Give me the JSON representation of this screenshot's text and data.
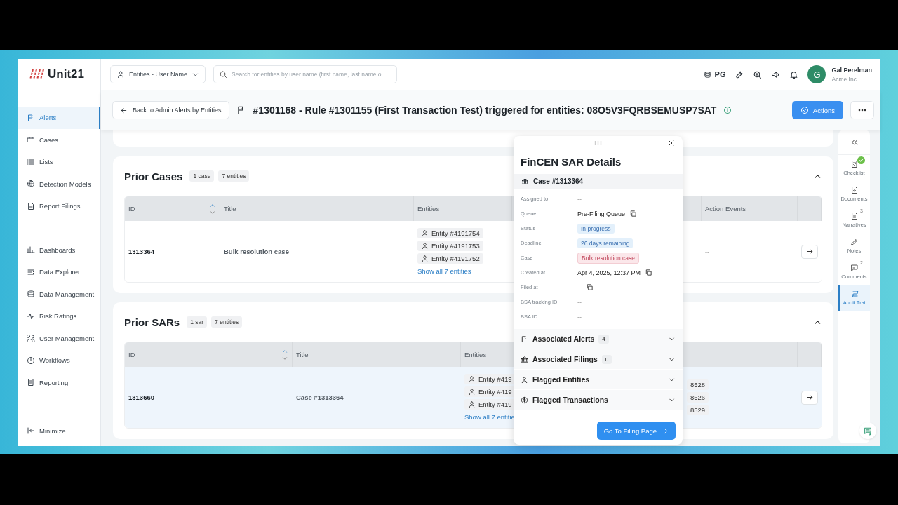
{
  "logo": "Unit21",
  "sidebar": {
    "groups": [
      [
        {
          "label": "Alerts",
          "selected": true
        },
        {
          "label": "Cases",
          "selected": false
        },
        {
          "label": "Lists",
          "selected": false
        },
        {
          "label": "Detection Models",
          "selected": false
        },
        {
          "label": "Report Filings",
          "selected": false
        }
      ],
      [
        {
          "label": "Dashboards",
          "selected": false
        },
        {
          "label": "Data Explorer",
          "selected": false
        },
        {
          "label": "Data Management",
          "selected": false
        },
        {
          "label": "Risk Ratings",
          "selected": false
        },
        {
          "label": "User Management",
          "selected": false
        },
        {
          "label": "Workflows",
          "selected": false
        },
        {
          "label": "Reporting",
          "selected": false
        }
      ]
    ],
    "minimize": "Minimize"
  },
  "topbar": {
    "entity_dropdown": "Entities - User Name",
    "search": {
      "placeholder": "Search for entities by user name (first name, last name o..."
    },
    "environment": "PG",
    "user": {
      "initial": "G",
      "name": "Gal Perelman",
      "org": "Acme Inc."
    }
  },
  "header": {
    "back": "Back to Admin Alerts by Entities",
    "title": "#1301168 - Rule #1301155 (First Transaction Test) triggered for entities: 08O5V3FQRBSEMUSP7SAT",
    "actions": "Actions"
  },
  "sections": [
    {
      "title": "Prior Cases",
      "badges": [
        "1 case",
        "7 entities"
      ],
      "expanded": true,
      "sort_ascending": true,
      "columns": [
        "ID",
        "Title",
        "Entities",
        "Action Events"
      ],
      "rows": [
        {
          "selected": false,
          "id": "1313364",
          "title": "Bulk resolution case",
          "entities": [
            "Entity #4191754",
            "Entity #4191753",
            "Entity #4191752"
          ],
          "show_all": "Show all 7 entities",
          "action_events": "--"
        }
      ]
    },
    {
      "title": "Prior SARs",
      "badges": [
        "1 sar",
        "7 entities"
      ],
      "expanded": true,
      "sort_ascending": true,
      "columns": [
        "ID",
        "Title",
        "Entities"
      ],
      "rows": [
        {
          "selected": true,
          "id": "1313660",
          "title": "Case #1313364",
          "entities": [
            "Entity #419",
            "Entity #419",
            "Entity #419"
          ],
          "show_all": "Show all 7 entitie",
          "column_4": [
            "8528",
            "8526",
            "8529"
          ]
        }
      ]
    }
  ],
  "panel": {
    "title": "FinCEN SAR Details",
    "case": "Case #1313364",
    "fields": [
      {
        "label": "Assigned to",
        "value": "--",
        "kind": "text",
        "copy": false
      },
      {
        "label": "Queue",
        "value": "Pre-Filing Queue",
        "kind": "text",
        "copy": true
      },
      {
        "label": "Status",
        "value": "In progress",
        "kind": "info",
        "copy": false
      },
      {
        "label": "Deadline",
        "value": "26 days remaining",
        "kind": "info",
        "copy": false
      },
      {
        "label": "Case",
        "value": "Bulk resolution case",
        "kind": "danger",
        "copy": false
      },
      {
        "label": "Created at",
        "value": "Apr 4, 2025, 12:37 PM",
        "kind": "text",
        "copy": true
      },
      {
        "label": "Filed at",
        "value": "--",
        "kind": "text",
        "copy": true
      },
      {
        "label": "BSA tracking ID",
        "value": "--",
        "kind": "text",
        "copy": false
      },
      {
        "label": "BSA ID",
        "value": "--",
        "kind": "text",
        "copy": false
      }
    ],
    "sections": [
      {
        "label": "Associated Alerts",
        "count": "4",
        "expanded": false
      },
      {
        "label": "Associated Filings",
        "count": "0",
        "expanded": false
      },
      {
        "label": "Flagged Entities",
        "expanded": false
      },
      {
        "label": "Flagged Transactions",
        "expanded": false
      }
    ],
    "button": "Go To Filing Page"
  },
  "rail": {
    "items": [
      {
        "label": "Checklist",
        "done": true,
        "selected": false
      },
      {
        "label": "Documents",
        "done": false,
        "selected": false
      },
      {
        "label": "Narratives",
        "count": "3",
        "done": false,
        "selected": false
      },
      {
        "label": "Notes",
        "done": false,
        "selected": false
      },
      {
        "label": "Comments",
        "count": "2",
        "done": false,
        "selected": false
      },
      {
        "label": "Audit Trail",
        "done": false,
        "selected": true
      }
    ]
  }
}
